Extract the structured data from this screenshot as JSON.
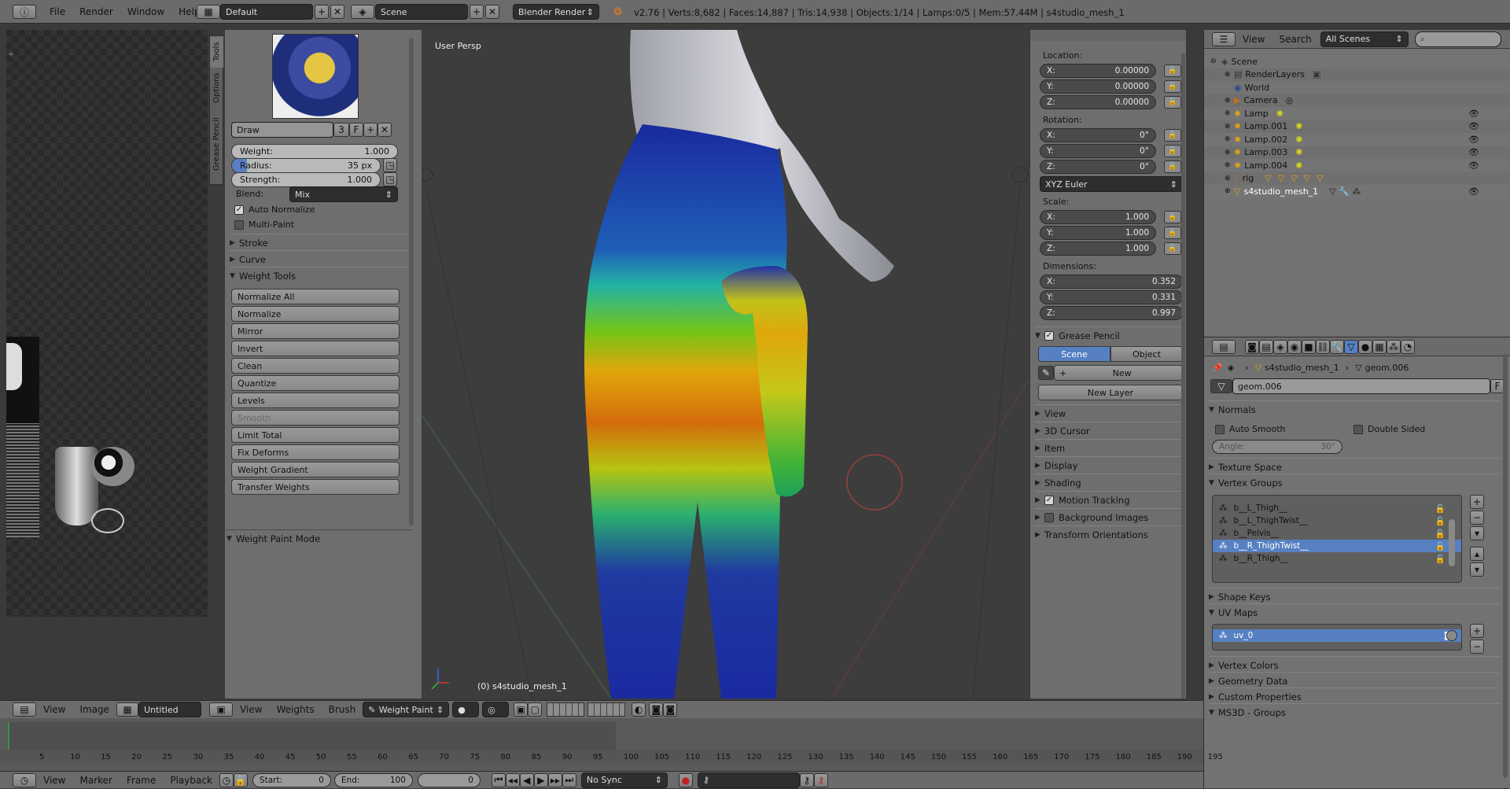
{
  "top_bar": {
    "menu": [
      "File",
      "Render",
      "Window",
      "Help"
    ],
    "layout_name": "Default",
    "scene_name": "Scene",
    "render_engine": "Blender Render",
    "stats": "v2.76 | Verts:8,682 | Faces:14,887 | Tris:14,938 | Objects:1/14 | Lamps:0/5 | Mem:57.44M | s4studio_mesh_1"
  },
  "tool_tabs": [
    "Tools",
    "Options",
    "Grease Pencil"
  ],
  "tools": {
    "brush_name": "Draw",
    "brush_users": "3",
    "brush_fake": "F",
    "weight_label": "Weight:",
    "weight_value": "1.000",
    "radius_label": "Radius:",
    "radius_value": "35 px",
    "strength_label": "Strength:",
    "strength_value": "1.000",
    "blend_label": "Blend:",
    "blend_value": "Mix",
    "auto_normalize": "Auto Normalize",
    "multi_paint": "Multi-Paint",
    "stroke": "Stroke",
    "curve": "Curve",
    "weight_tools": "Weight Tools",
    "buttons": [
      "Normalize All",
      "Normalize",
      "Mirror",
      "Invert",
      "Clean",
      "Quantize",
      "Levels",
      "Smooth",
      "Limit Total",
      "Fix Deforms",
      "Weight Gradient",
      "Transfer Weights"
    ],
    "mode_panel": "Weight Paint Mode"
  },
  "viewport": {
    "view_label": "User Persp",
    "object_label": "(0) s4studio_mesh_1"
  },
  "properties_n": {
    "location_label": "Location:",
    "location": [
      "X:",
      "0.00000",
      "Y:",
      "0.00000",
      "Z:",
      "0.00000"
    ],
    "rotation_label": "Rotation:",
    "rotation": [
      "X:",
      "0°",
      "Y:",
      "0°",
      "Z:",
      "0°"
    ],
    "rotation_mode": "XYZ Euler",
    "scale_label": "Scale:",
    "scale": [
      "X:",
      "1.000",
      "Y:",
      "1.000",
      "Z:",
      "1.000"
    ],
    "dimensions_label": "Dimensions:",
    "dimensions": [
      "X:",
      "0.352",
      "Y:",
      "0.331",
      "Z:",
      "0.997"
    ],
    "grease_pencil": "Grease Pencil",
    "gp_scene": "Scene",
    "gp_object": "Object",
    "gp_new": "New",
    "gp_new_layer": "New Layer",
    "sections": [
      "View",
      "3D Cursor",
      "Item",
      "Display",
      "Shading",
      "Motion Tracking",
      "Background Images",
      "Transform Orientations"
    ]
  },
  "outliner": {
    "view_menu": "View",
    "search_menu": "Search",
    "filter": "All Scenes",
    "items": [
      "Scene",
      "RenderLayers",
      "World",
      "Camera",
      "Lamp",
      "Lamp.001",
      "Lamp.002",
      "Lamp.003",
      "Lamp.004",
      "rig",
      "s4studio_mesh_1"
    ]
  },
  "properties": {
    "breadcrumb_obj": "s4studio_mesh_1",
    "breadcrumb_data": "geom.006",
    "datablock": "geom.006",
    "datablock_fake": "F",
    "normals": "Normals",
    "auto_smooth": "Auto Smooth",
    "double_sided": "Double Sided",
    "angle_label": "Angle:",
    "angle_value": "30°",
    "texture_space": "Texture Space",
    "vertex_groups": "Vertex Groups",
    "groups": [
      "b__L_Thigh__",
      "b__L_ThighTwist__",
      "b__Pelvis__",
      "b__R_ThighTwist__",
      "b__R_Thigh__"
    ],
    "shape_keys": "Shape Keys",
    "uv_maps": "UV Maps",
    "uv_name": "uv_0",
    "vertex_colors": "Vertex Colors",
    "geometry_data": "Geometry Data",
    "custom_properties": "Custom Properties",
    "ms3d": "MS3D - Groups"
  },
  "image_editor": {
    "view": "View",
    "image": "Image",
    "image_name": "Untitled"
  },
  "viewport_header": {
    "view": "View",
    "weights": "Weights",
    "brush": "Brush",
    "mode": "Weight Paint"
  },
  "timeline": {
    "ticks": [
      "5",
      "10",
      "15",
      "20",
      "25",
      "30",
      "35",
      "40",
      "45",
      "50",
      "55",
      "60",
      "65",
      "70",
      "75",
      "80",
      "85",
      "90",
      "95",
      "100",
      "105",
      "110",
      "115",
      "120",
      "125",
      "130",
      "135",
      "140",
      "145",
      "150",
      "155",
      "160",
      "165",
      "170",
      "175",
      "180",
      "185",
      "190",
      "195"
    ],
    "view": "View",
    "marker": "Marker",
    "frame": "Frame",
    "playback": "Playback",
    "start_label": "Start:",
    "start_value": "0",
    "end_label": "End:",
    "end_value": "100",
    "current": "0",
    "sync": "No Sync"
  }
}
